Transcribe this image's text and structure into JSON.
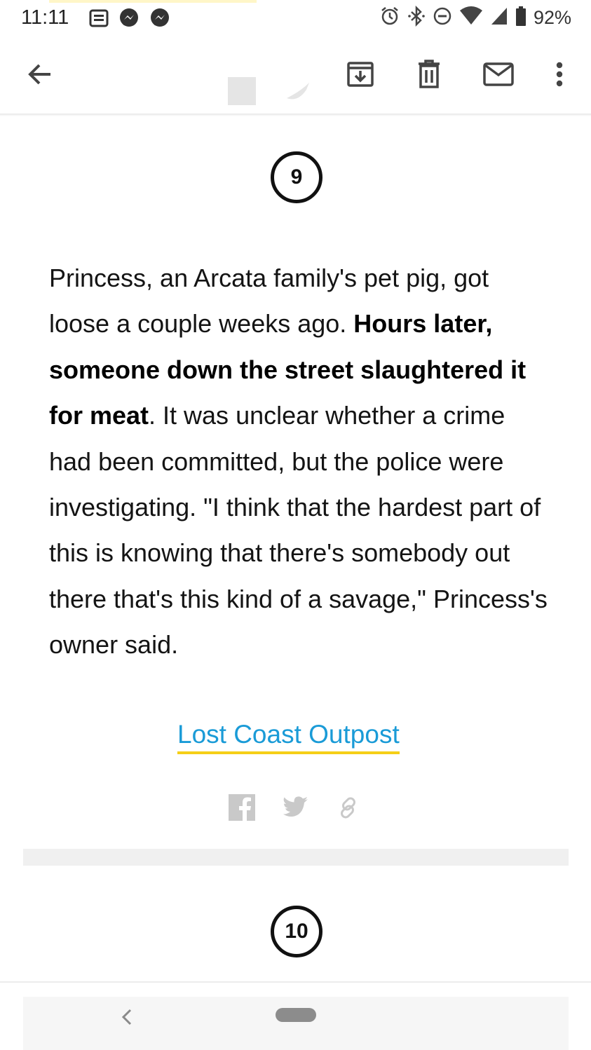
{
  "status_bar": {
    "time": "11:11",
    "left_icons": [
      "notes-icon",
      "messenger-icon",
      "messenger-icon"
    ],
    "right_icons": [
      "alarm-icon",
      "bluetooth-icon",
      "do-not-disturb-icon",
      "wifi-icon",
      "cell-signal-icon",
      "battery-icon"
    ],
    "battery": "92%"
  },
  "toolbar": {
    "icons": [
      "back-arrow-icon",
      "archive-icon",
      "trash-icon",
      "mail-icon",
      "more-vert-icon"
    ]
  },
  "item": {
    "number": "9",
    "paragraph": {
      "text_before": "Princess, an Arcata family's pet pig, got loose a couple weeks ago. ",
      "bold": "Hours later, someone down the street slaughtered it for meat",
      "text_after": ". It was unclear whether a crime had been committed, but the police were investigating. \"I think that the hardest part of this is knowing that there's somebody out there that's this kind of a savage,\" Princess's owner said."
    },
    "source_link": "Lost Coast Outpost",
    "share_icons": [
      "facebook-icon",
      "twitter-icon",
      "link-icon"
    ]
  },
  "next_item": {
    "number": "10"
  },
  "nav_bar": {
    "icons": [
      "back-chevron-icon",
      "home-pill-icon"
    ]
  },
  "colors": {
    "link": "#1a9bd7",
    "link_underline": "#f5cf17",
    "text": "#141414"
  }
}
